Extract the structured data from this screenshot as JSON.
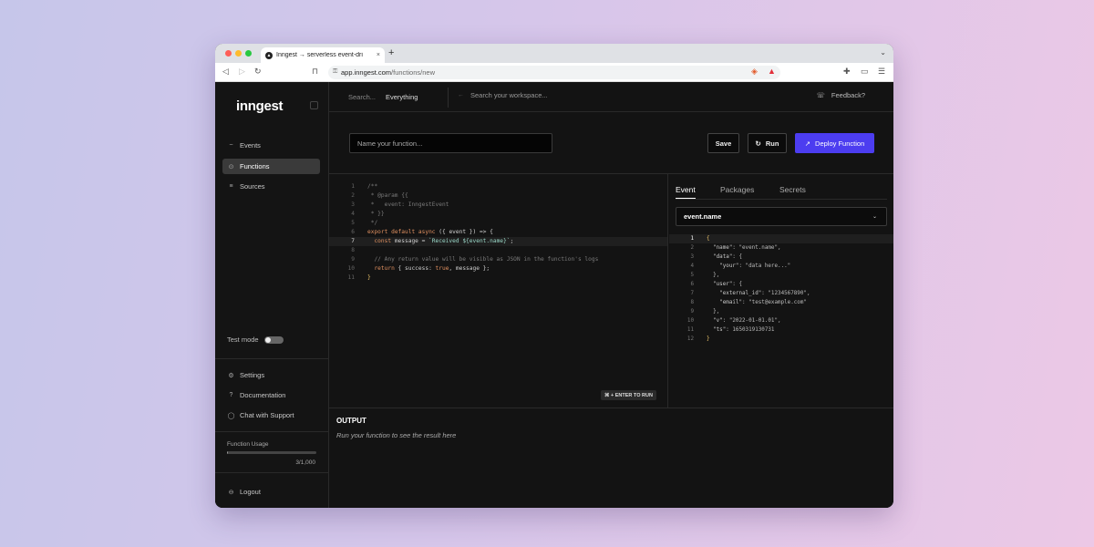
{
  "browser": {
    "tab_title": "Inngest → serverless event-dri",
    "tab_favicon": "inngest-logo",
    "tab_close": "×",
    "new_tab": "+",
    "tab_menu": "⌄",
    "url_host": "app.inngest.com",
    "url_path": "/functions/new",
    "nav_back": "◁",
    "nav_forward": "▷",
    "nav_reload": "↻",
    "bookmark": "⊓",
    "lock": "🔒",
    "ext1": "◈",
    "ext2": "▲",
    "ext3": "✚",
    "ext4": "▭",
    "ext5": "☰"
  },
  "colors": {
    "accent": "#4c3df0",
    "sidebar_active": "#3a3a3a",
    "background": "#131313"
  },
  "sidebar": {
    "logo": "inngest",
    "items": [
      {
        "label": "Events",
        "icon": "~"
      },
      {
        "label": "Functions",
        "icon": "⊙"
      },
      {
        "label": "Sources",
        "icon": "≡"
      }
    ],
    "test_mode_label": "Test mode",
    "bottom_items": [
      {
        "label": "Settings",
        "icon": "⚙"
      },
      {
        "label": "Documentation",
        "icon": "?"
      },
      {
        "label": "Chat with Support",
        "icon": "◯"
      }
    ],
    "usage": {
      "label": "Function Usage",
      "count": "3/1,000",
      "fraction": 0.003
    },
    "logout": {
      "label": "Logout",
      "icon": "⊖"
    }
  },
  "topbar": {
    "search_label": "Search...",
    "search_scope": "Everything",
    "workspace_search": "Search your workspace...",
    "workspace_icon": "←",
    "feedback": "Feedback?",
    "feedback_icon": "☏"
  },
  "function_bar": {
    "name_placeholder": "Name your function...",
    "save": "Save",
    "run": "Run",
    "run_icon": "↻",
    "deploy": "Deploy Function",
    "deploy_icon": "↗"
  },
  "editor": {
    "hint": "⌘ + ENTER TO RUN",
    "lines": [
      "/**",
      " * @param {{",
      " *   event: InngestEvent",
      " * }}",
      " */",
      "export default async ({ event }) => {",
      "  const message = `Received ${event.name}`;",
      "",
      "  // Any return value will be visible as JSON in the function's logs",
      "  return { success: true, message };",
      "}"
    ]
  },
  "panel": {
    "tabs": [
      "Event",
      "Packages",
      "Secrets"
    ],
    "select_value": "event.name",
    "json_lines": [
      "{",
      "  \"name\": \"event.name\",",
      "  \"data\": {",
      "    \"your\": \"data here...\"",
      "  },",
      "  \"user\": {",
      "    \"external_id\": \"1234567890\",",
      "    \"email\": \"test@example.com\"",
      "  },",
      "  \"v\": \"2022-01-01.01\",",
      "  \"ts\": 1650319130731",
      "}"
    ]
  },
  "output": {
    "title": "OUTPUT",
    "hint": "Run your function to see the result here"
  }
}
